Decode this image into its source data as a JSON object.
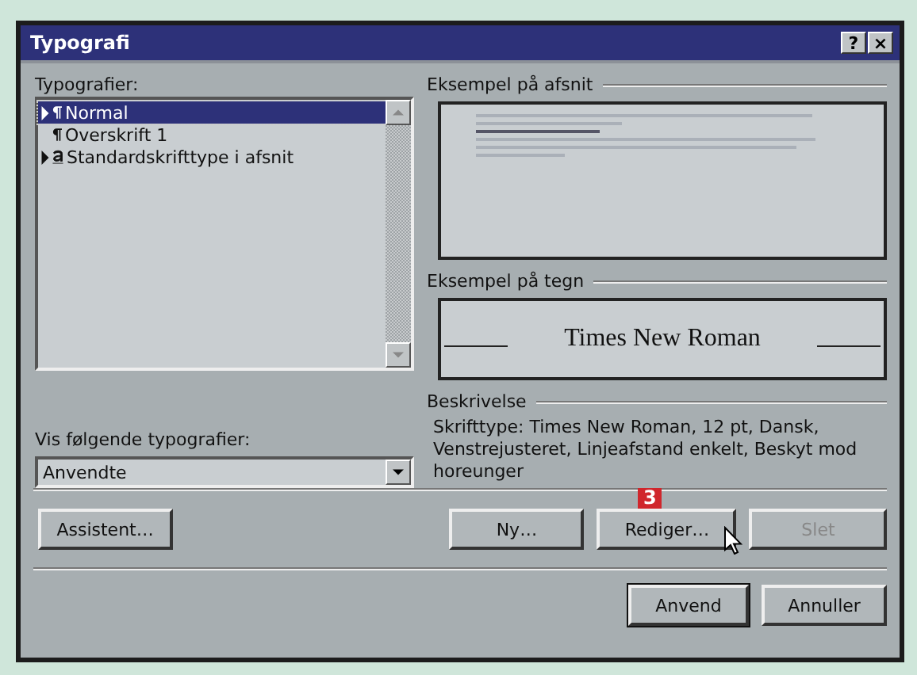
{
  "window": {
    "title": "Typografi",
    "help_button": "?",
    "close_button": "×"
  },
  "styles": {
    "label": "Typografier:",
    "items": [
      {
        "name": "Normal",
        "kind": "paragraph",
        "current": true,
        "selected": true
      },
      {
        "name": "Overskrift 1",
        "kind": "paragraph",
        "current": false,
        "selected": false
      },
      {
        "name": "Standardskrifttype i afsnit",
        "kind": "character",
        "current": true,
        "selected": false
      }
    ]
  },
  "show": {
    "label": "Vis følgende typografier:",
    "value": "Anvendte"
  },
  "paragraph_preview": {
    "label": "Eksempel på afsnit"
  },
  "character_preview": {
    "label": "Eksempel på tegn",
    "sample": "Times New Roman"
  },
  "description": {
    "label": "Beskrivelse",
    "text": "Skrifttype: Times New Roman, 12 pt, Dansk, Venstrejusteret, Linjeafstand enkelt, Beskyt mod horeunger"
  },
  "buttons": [
    {
      "label": "Assistent…",
      "disabled": false
    },
    {
      "label": "Ny…",
      "disabled": false
    },
    {
      "label": "Rediger…",
      "disabled": false
    },
    {
      "label": "Slet",
      "disabled": true
    }
  ],
  "callout": {
    "label": "3"
  },
  "footer_buttons": [
    {
      "label": "Anvend",
      "default": true
    },
    {
      "label": "Annuller",
      "default": false
    }
  ]
}
